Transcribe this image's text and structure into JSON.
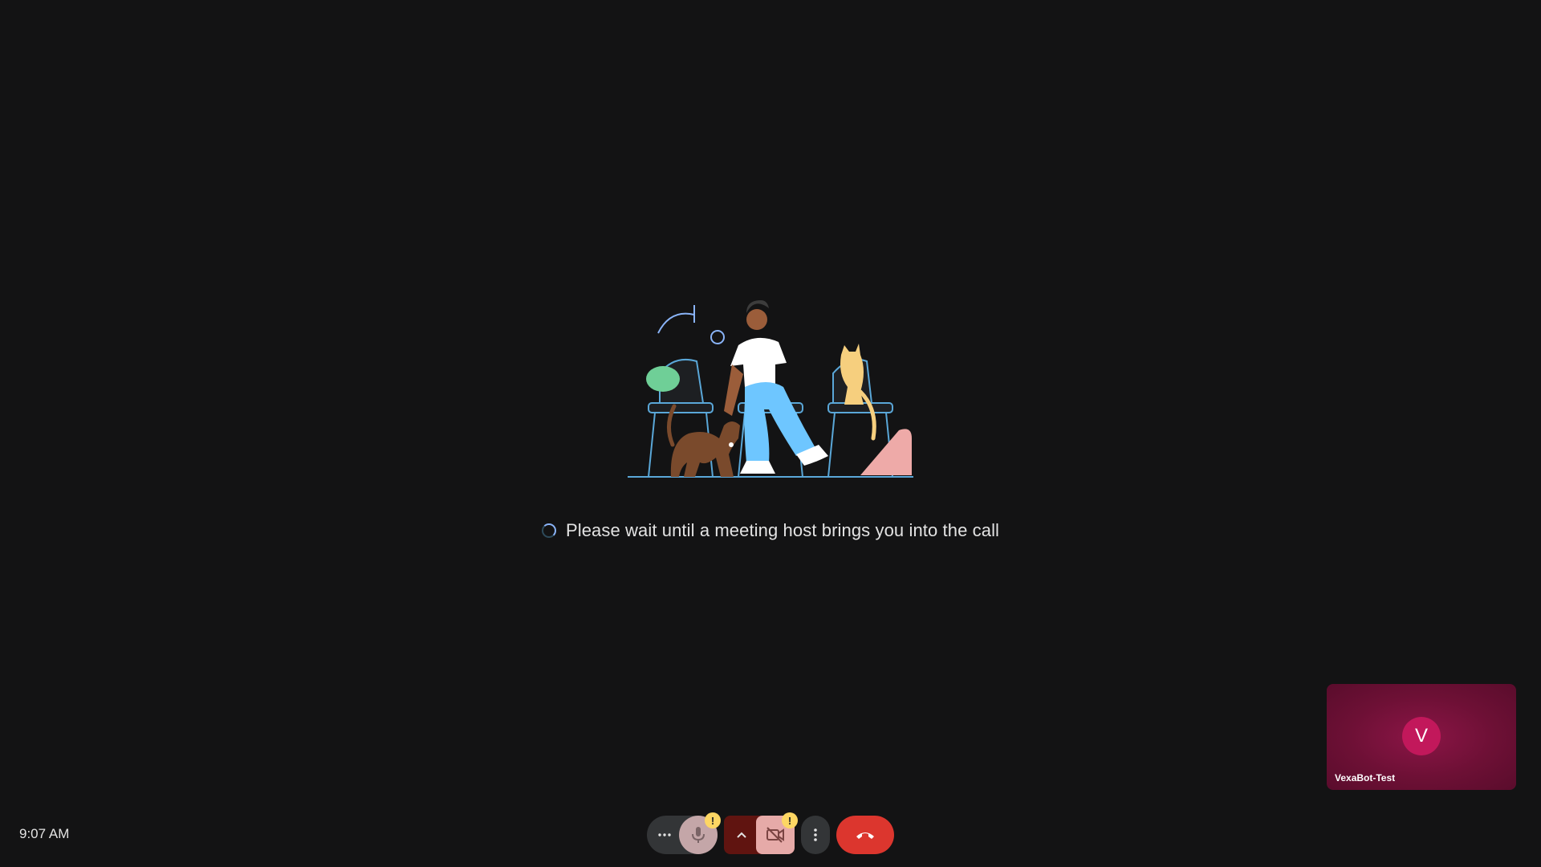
{
  "waiting": {
    "message": "Please wait until a meeting host brings you into the call"
  },
  "self_tile": {
    "avatar_initial": "V",
    "name": "VexaBot-Test"
  },
  "bottom_bar": {
    "time": "9:07 AM",
    "warning_badge": "!",
    "mic_state": "muted-with-warning",
    "camera_state": "off-with-warning"
  },
  "icons": {
    "audio_options": "more-horiz-icon",
    "mic": "mic-icon",
    "video_options": "chevron-up-icon",
    "camera": "videocam-off-icon",
    "more": "more-vert-icon",
    "leave": "call-end-icon"
  },
  "colors": {
    "background": "#131314",
    "leave_red": "#dc362e",
    "warning_yellow": "#fdd663",
    "avatar_pink": "#c2185b"
  }
}
